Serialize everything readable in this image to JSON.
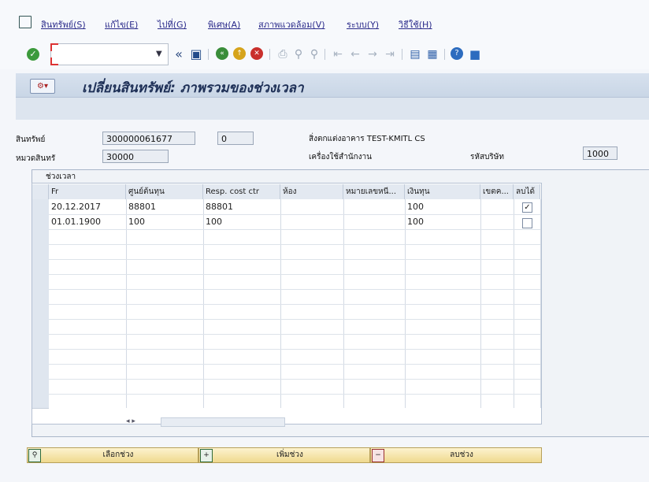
{
  "menu": {
    "items": [
      "สินทรัพย์(S)",
      "แก้ไข(E)",
      "ไปที่(G)",
      "พิเศษ(A)",
      "สภาพแวดล้อม(V)",
      "ระบบ(Y)",
      "วิธีใช้(H)"
    ]
  },
  "toolbar": {
    "command_value": "",
    "icons": [
      "check-icon",
      "back-double-arrow-icon",
      "save-icon",
      "back-icon",
      "exit-icon",
      "cancel-icon",
      "print-icon",
      "find-icon",
      "find-next-icon",
      "first-page-icon",
      "prev-page-icon",
      "next-page-icon",
      "last-page-icon",
      "new-session-icon",
      "shortcut-icon",
      "help-icon",
      "customize-layout-icon"
    ]
  },
  "title": "เปลี่ยนสินทรัพย์: ภาพรวมของช่วงเวลา",
  "header": {
    "asset_label": "สินทรัพย์",
    "asset_value": "300000061677",
    "subnumber_value": "0",
    "asset_desc": "สิ่งตกแต่งอาคาร TEST-KMITL CS",
    "class_label": "หมวดสินทรั",
    "class_value": "30000",
    "class_desc": "เครื่องใช้สำนักงาน",
    "company_label": "รหัสบริษัท",
    "company_value": "1000"
  },
  "timebox": {
    "title": "ช่วงเวลา",
    "columns": [
      "Fr",
      "ศูนย์ต้นทุน",
      "Resp. cost ctr",
      "ห้อง",
      "หมายเลขหนี...",
      "เงินทุน",
      "เขตค...",
      "ลบได้"
    ],
    "rows": [
      {
        "from": "20.12.2017",
        "cost_center": "88801",
        "resp_cost_ctr": "88801",
        "room": "",
        "license_plate": "",
        "fund": "100",
        "area": "",
        "deletable": true
      },
      {
        "from": "01.01.1900",
        "cost_center": "100",
        "resp_cost_ctr": "100",
        "room": "",
        "license_plate": "",
        "fund": "100",
        "area": "",
        "deletable": false
      }
    ],
    "scroll_arrows": "◂ ▸"
  },
  "buttons": {
    "select_interval": "เลือกช่วง",
    "add_interval": "เพิ่มช่วง",
    "delete_interval": "ลบช่วง"
  },
  "colors": {
    "title_text": "#1d2f56",
    "button_bg": "#efd98e",
    "menu_text": "#2a2a8a"
  }
}
